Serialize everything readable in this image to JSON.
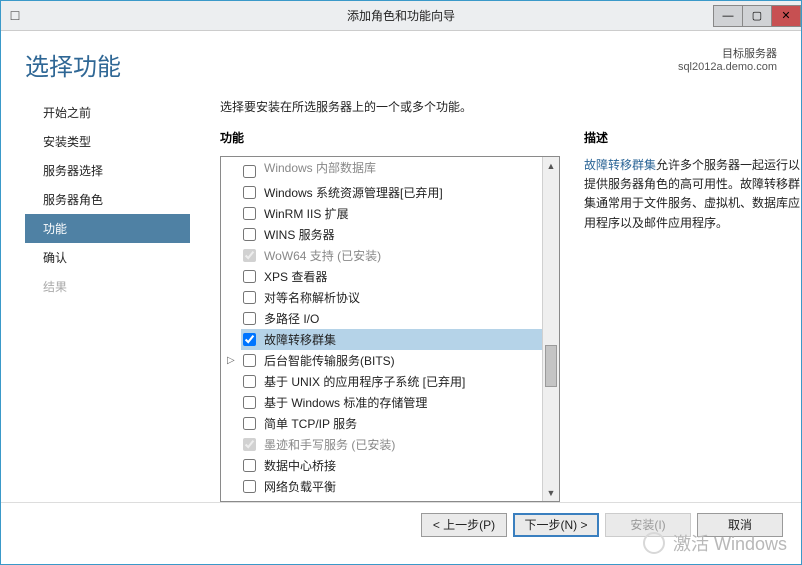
{
  "window": {
    "title": "添加角色和功能向导"
  },
  "header": {
    "page_title": "选择功能",
    "target_label": "目标服务器",
    "target_server": "sql2012a.demo.com"
  },
  "nav": {
    "steps": [
      {
        "label": "开始之前",
        "state": "normal"
      },
      {
        "label": "安装类型",
        "state": "normal"
      },
      {
        "label": "服务器选择",
        "state": "normal"
      },
      {
        "label": "服务器角色",
        "state": "normal"
      },
      {
        "label": "功能",
        "state": "active"
      },
      {
        "label": "确认",
        "state": "normal"
      },
      {
        "label": "结果",
        "state": "disabled"
      }
    ]
  },
  "main": {
    "instruction": "选择要安装在所选服务器上的一个或多个功能。",
    "panel_left_title": "功能",
    "panel_right_title": "描述"
  },
  "features": [
    {
      "label": "Windows 内部数据库",
      "checked": false,
      "cut_top": true
    },
    {
      "label": "Windows 系统资源管理器[已弃用]",
      "checked": false
    },
    {
      "label": "WinRM IIS 扩展",
      "checked": false
    },
    {
      "label": "WINS 服务器",
      "checked": false
    },
    {
      "label": "WoW64 支持 (已安装)",
      "checked": true,
      "installed": true
    },
    {
      "label": "XPS 查看器",
      "checked": false
    },
    {
      "label": "对等名称解析协议",
      "checked": false
    },
    {
      "label": "多路径 I/O",
      "checked": false
    },
    {
      "label": "故障转移群集",
      "checked": true,
      "selected": true
    },
    {
      "label": "后台智能传输服务(BITS)",
      "checked": false,
      "expandable": true
    },
    {
      "label": "基于 UNIX 的应用程序子系统 [已弃用]",
      "checked": false
    },
    {
      "label": "基于 Windows 标准的存储管理",
      "checked": false
    },
    {
      "label": "简单 TCP/IP 服务",
      "checked": false
    },
    {
      "label": "墨迹和手写服务 (已安装)",
      "checked": true,
      "installed": true
    },
    {
      "label": "数据中心桥接",
      "checked": false
    },
    {
      "label": "网络负载平衡",
      "checked": false
    }
  ],
  "description": {
    "link_text": "故障转移群集",
    "body": "允许多个服务器一起运行以提供服务器角色的高可用性。故障转移群集通常用于文件服务、虚拟机、数据库应用程序以及邮件应用程序。"
  },
  "footer": {
    "prev": "< 上一步(P)",
    "next": "下一步(N) >",
    "install": "安装(I)",
    "cancel": "取消"
  },
  "watermark": {
    "line1": "激活 Windows"
  }
}
